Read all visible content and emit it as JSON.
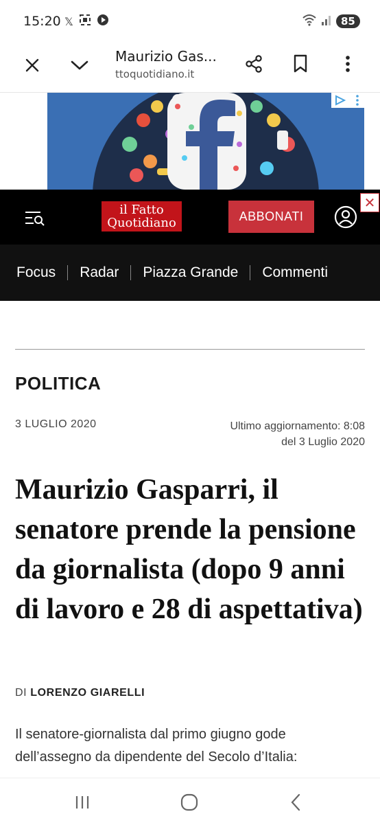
{
  "status_bar": {
    "time": "15:20",
    "battery": "85",
    "icons_left": [
      "x-icon",
      "screenshot-icon",
      "record-icon"
    ],
    "icons_right": [
      "wifi-icon",
      "signal-icon"
    ]
  },
  "toolbar": {
    "title": "Maurizio Gas...",
    "url": "ttoquotidiano.it"
  },
  "site": {
    "logo_line1": "il Fatto",
    "logo_line2": "Quotidiano",
    "subscribe_label": "ABBONATI",
    "close_label": "✕"
  },
  "nav": {
    "items": [
      "Focus",
      "Radar",
      "Piazza Grande",
      "Commenti"
    ]
  },
  "article": {
    "category": "POLITICA",
    "date": "3 LUGLIO 2020",
    "updated_line1": "Ultimo aggiornamento: 8:08",
    "updated_line2": "del 3 Luglio 2020",
    "headline": "Maurizio Gasparri, il senatore prende la pensione da giornalista (dopo 9 anni di lavoro e 28 di aspettativa)",
    "byline_prefix": "DI",
    "author": "LORENZO GIARELLI",
    "body_line1": "Il senatore-giornalista dal primo giugno gode",
    "body_line2": "dell’assegno da dipendente del Secolo d’Italia:"
  },
  "colors": {
    "brand_red": "#c2141a",
    "subscribe_red": "#c8323b",
    "header_bg": "#000000"
  }
}
